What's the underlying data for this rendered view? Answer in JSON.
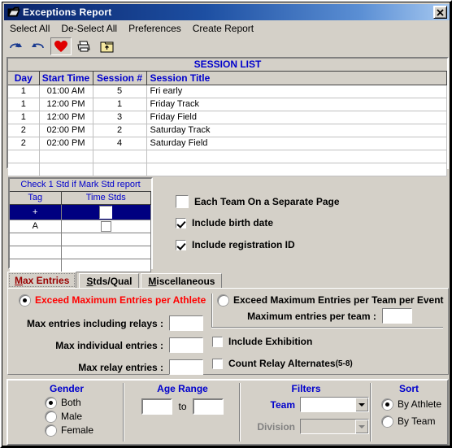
{
  "window": {
    "title": "Exceptions Report",
    "icon": "report-window-icon",
    "close_label": "✕"
  },
  "menu": {
    "items": [
      {
        "label": "Select All",
        "name": "menu-select-all"
      },
      {
        "label": "De-Select All",
        "name": "menu-de-select-all"
      },
      {
        "label": "Preferences",
        "name": "menu-preferences"
      },
      {
        "label": "Create Report",
        "name": "menu-create-report"
      }
    ]
  },
  "toolbar": {
    "buttons": [
      {
        "icon": "redo-icon",
        "pressed": false
      },
      {
        "icon": "undo-icon",
        "pressed": false
      },
      {
        "icon": "heart-icon",
        "pressed": true
      },
      {
        "icon": "printer-icon",
        "pressed": false
      },
      {
        "icon": "export-folder-icon",
        "pressed": false
      }
    ]
  },
  "session_list": {
    "title": "SESSION LIST",
    "columns": [
      "Day",
      "Start Time",
      "Session #",
      "Session Title"
    ],
    "rows": [
      {
        "day": "1",
        "start_time": "01:00 AM",
        "session_num": "5",
        "title": "Fri early"
      },
      {
        "day": "1",
        "start_time": "12:00 PM",
        "session_num": "1",
        "title": "Friday Track"
      },
      {
        "day": "1",
        "start_time": "12:00 PM",
        "session_num": "3",
        "title": "Friday Field"
      },
      {
        "day": "2",
        "start_time": "02:00 PM",
        "session_num": "2",
        "title": "Saturday Track"
      },
      {
        "day": "2",
        "start_time": "02:00 PM",
        "session_num": "4",
        "title": "Saturday Field"
      },
      {
        "day": "",
        "start_time": "",
        "session_num": "",
        "title": ""
      },
      {
        "day": "",
        "start_time": "",
        "session_num": "",
        "title": ""
      }
    ]
  },
  "tag_list": {
    "title": "Check 1 Std if Mark Std report",
    "columns": [
      "Tag",
      "Time Stds"
    ],
    "rows": [
      {
        "tag": "+",
        "checked": false,
        "selected": true
      },
      {
        "tag": "A",
        "checked": false,
        "selected": false
      },
      {
        "tag": "",
        "checked": null,
        "selected": false
      },
      {
        "tag": "",
        "checked": null,
        "selected": false
      },
      {
        "tag": "",
        "checked": null,
        "selected": false
      }
    ]
  },
  "report_options": [
    {
      "label": "Each Team On a Separate Page",
      "checked": false,
      "name": "each-team-separate-page-checkbox"
    },
    {
      "label": "Include birth date",
      "checked": true,
      "name": "include-birth-date-checkbox"
    },
    {
      "label": "Include registration ID",
      "checked": true,
      "name": "include-registration-id-checkbox"
    }
  ],
  "tabs": [
    {
      "label": "Max Entries",
      "mnemonic": "M",
      "rest": "ax Entries",
      "active": true,
      "name": "tab-max-entries"
    },
    {
      "label": "Stds/Qual",
      "mnemonic": "S",
      "rest": "tds/Qual",
      "active": false,
      "name": "tab-stds-qual"
    },
    {
      "label": "Miscellaneous",
      "mnemonic": "M",
      "rest": "iscellaneous",
      "active": false,
      "name": "tab-miscellaneous"
    }
  ],
  "max_entries": {
    "athlete_radio": {
      "label": "Exceed Maximum Entries per Athlete",
      "selected": true,
      "color": "#ff0000"
    },
    "team_radio": {
      "label": "Exceed Maximum Entries per Team per Event",
      "selected": false
    },
    "fields": [
      {
        "label": "Max entries including relays :",
        "value": "",
        "name": "max-entries-including-relays-input"
      },
      {
        "label": "Max individual entries :",
        "value": "",
        "name": "max-individual-entries-input"
      },
      {
        "label": "Max relay entries :",
        "value": "",
        "name": "max-relay-entries-input"
      }
    ],
    "team_field": {
      "label": "Maximum entries per team :",
      "value": "",
      "name": "maximum-entries-per-team-input"
    },
    "checkboxes": [
      {
        "label": "Include Exhibition",
        "checked": false,
        "name": "include-exhibition-checkbox"
      },
      {
        "label": "Count Relay Alternates ",
        "suffix": "(5-8)",
        "checked": false,
        "name": "count-relay-alternates-checkbox"
      }
    ]
  },
  "bottom": {
    "gender": {
      "title": "Gender",
      "options": [
        {
          "label": "Both",
          "selected": true
        },
        {
          "label": "Male",
          "selected": false
        },
        {
          "label": "Female",
          "selected": false
        }
      ]
    },
    "age_range": {
      "title": "Age Range",
      "from_value": "",
      "to_label": "to",
      "to_value": ""
    },
    "filters": {
      "title": "Filters",
      "team_label": "Team",
      "team_value": "",
      "division_label": "Division",
      "division_value": "",
      "division_disabled": true
    },
    "sort": {
      "title": "Sort",
      "options": [
        {
          "label": "By Athlete",
          "selected": true
        },
        {
          "label": "By Team",
          "selected": false
        }
      ]
    }
  }
}
